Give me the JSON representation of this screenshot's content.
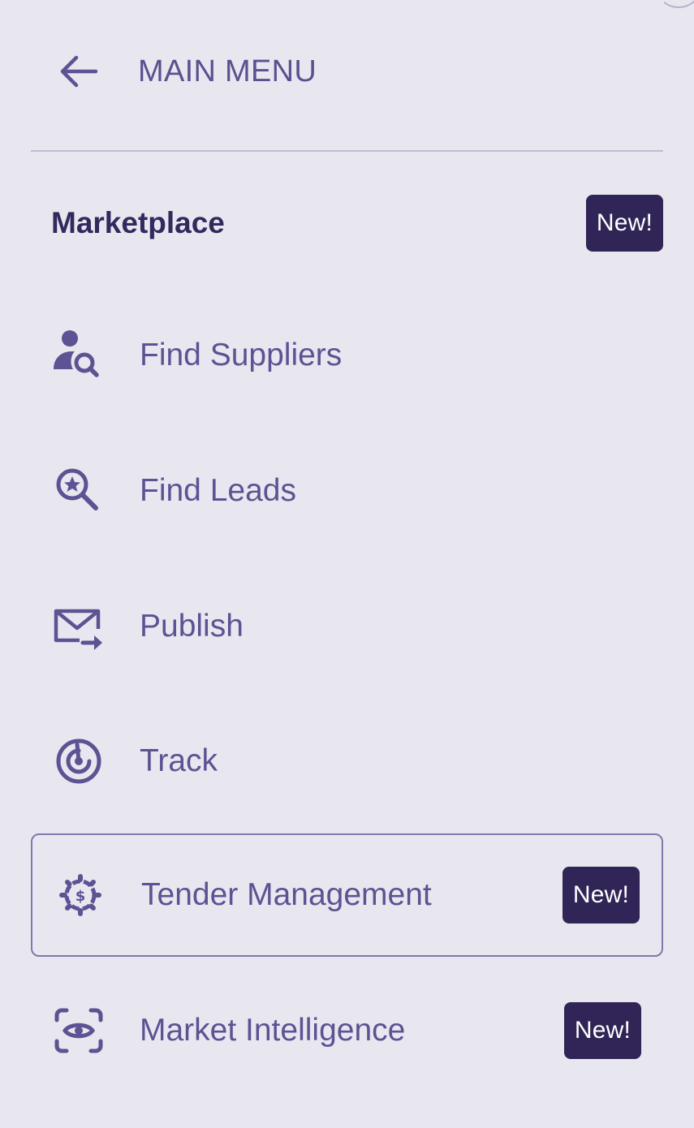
{
  "nav": {
    "back_label": "MAIN MENU"
  },
  "section": {
    "title": "Marketplace",
    "badge": "New!"
  },
  "items": [
    {
      "label": "Find Suppliers",
      "icon": "user-search-icon"
    },
    {
      "label": "Find Leads",
      "icon": "search-star-icon"
    },
    {
      "label": "Publish",
      "icon": "mail-send-icon"
    },
    {
      "label": "Track",
      "icon": "radar-icon"
    },
    {
      "label": "Tender Management",
      "icon": "gear-dollar-icon",
      "badge": "New!",
      "selected": true
    },
    {
      "label": "Market Intelligence",
      "icon": "eye-focus-icon",
      "badge": "New!"
    }
  ],
  "colors": {
    "background": "#e8e7ef",
    "text": "#5d5293",
    "heading": "#33295f",
    "badge_bg": "#302556",
    "badge_text": "#ffffff",
    "divider": "#bfbbd8"
  }
}
